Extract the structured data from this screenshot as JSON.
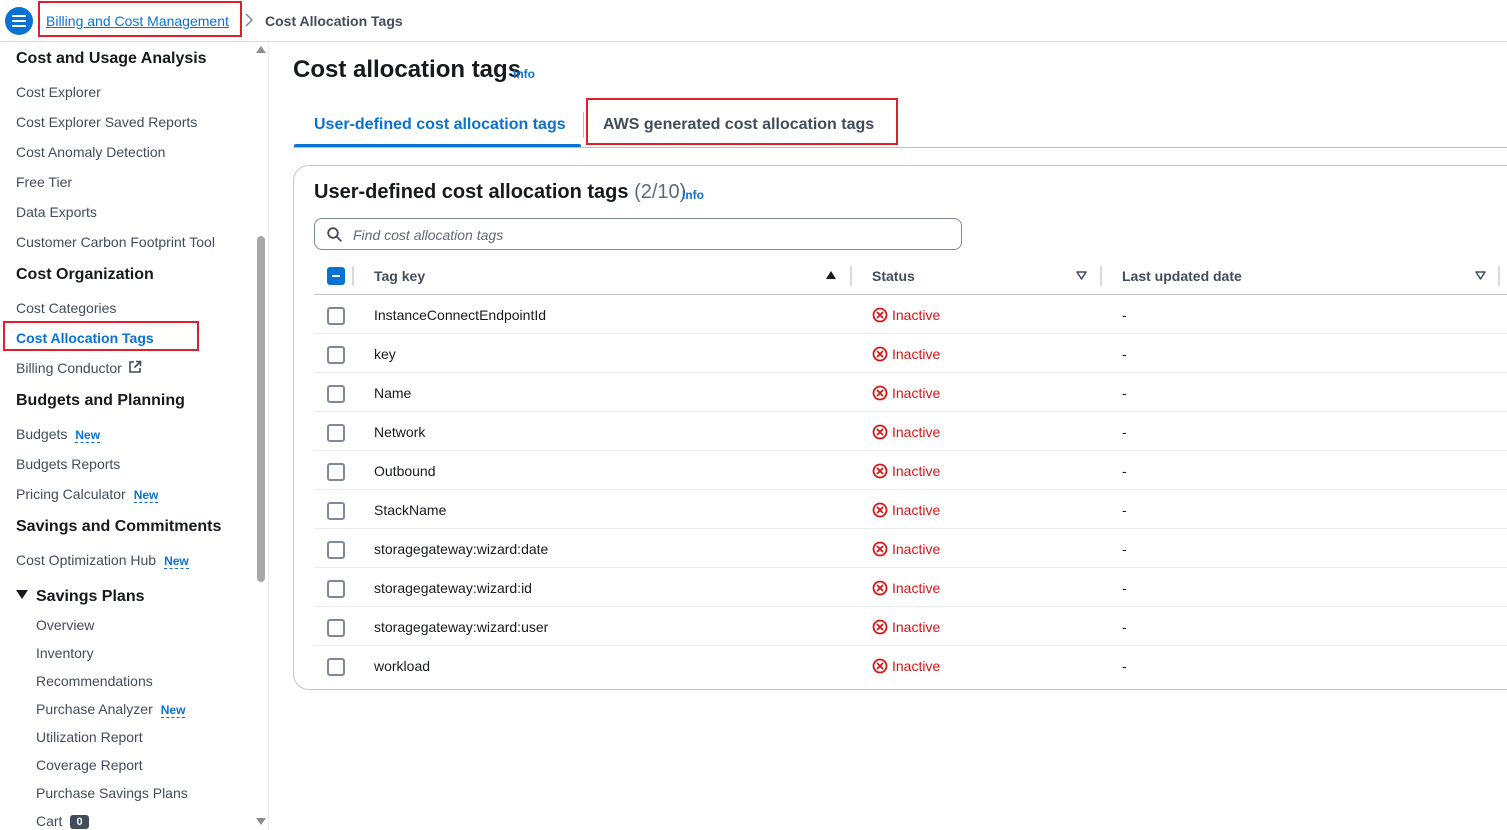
{
  "breadcrumb": {
    "parent": "Billing and Cost Management",
    "current": "Cost Allocation Tags"
  },
  "sidebar": {
    "sections": [
      {
        "title": "Cost and Usage Analysis",
        "items": [
          "Cost Explorer",
          "Cost Explorer Saved Reports",
          "Cost Anomaly Detection",
          "Free Tier",
          "Data Exports",
          "Customer Carbon Footprint Tool"
        ]
      },
      {
        "title": "Cost Organization",
        "items": [
          "Cost Categories",
          "Cost Allocation Tags",
          "Billing Conductor"
        ]
      },
      {
        "title": "Budgets and Planning",
        "items": [
          "Budgets",
          "Budgets Reports",
          "Pricing Calculator"
        ]
      },
      {
        "title": "Savings and Commitments",
        "items": [
          "Cost Optimization Hub"
        ]
      }
    ],
    "savings_plans": {
      "title": "Savings Plans",
      "items": [
        "Overview",
        "Inventory",
        "Recommendations",
        "Purchase Analyzer",
        "Utilization Report",
        "Coverage Report",
        "Purchase Savings Plans",
        "Cart"
      ]
    },
    "new_badge": "New",
    "cart_count": "0",
    "active_item": "Cost Allocation Tags"
  },
  "page": {
    "title": "Cost allocation tags",
    "info": "Info"
  },
  "tabs": [
    {
      "label": "User-defined cost allocation tags",
      "active": true
    },
    {
      "label": "AWS generated cost allocation tags",
      "active": false
    }
  ],
  "panel": {
    "title": "User-defined cost allocation tags",
    "count": "(2/10)",
    "info": "Info",
    "search_placeholder": "Find cost allocation tags"
  },
  "table": {
    "columns": [
      "Tag key",
      "Status",
      "Last updated date"
    ],
    "rows": [
      {
        "key": "InstanceConnectEndpointId",
        "status": "Inactive",
        "updated": "-"
      },
      {
        "key": "key",
        "status": "Inactive",
        "updated": "-"
      },
      {
        "key": "Name",
        "status": "Inactive",
        "updated": "-"
      },
      {
        "key": "Network",
        "status": "Inactive",
        "updated": "-"
      },
      {
        "key": "Outbound",
        "status": "Inactive",
        "updated": "-"
      },
      {
        "key": "StackName",
        "status": "Inactive",
        "updated": "-"
      },
      {
        "key": "storagegateway:wizard:date",
        "status": "Inactive",
        "updated": "-"
      },
      {
        "key": "storagegateway:wizard:id",
        "status": "Inactive",
        "updated": "-"
      },
      {
        "key": "storagegateway:wizard:user",
        "status": "Inactive",
        "updated": "-"
      },
      {
        "key": "workload",
        "status": "Inactive",
        "updated": "-"
      }
    ]
  },
  "colors": {
    "accent": "#0972d3",
    "error": "#d91515",
    "highlight": "#e01e2d"
  }
}
